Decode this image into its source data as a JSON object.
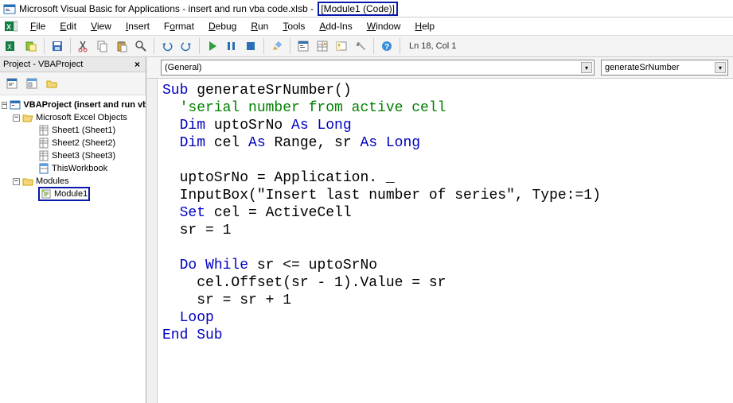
{
  "title": {
    "prefix": "Microsoft Visual Basic for Applications - insert and run vba code.xlsb - ",
    "module": "[Module1 (Code)]"
  },
  "menu": {
    "file": "File",
    "edit": "Edit",
    "view": "View",
    "insert": "Insert",
    "format": "Format",
    "debug": "Debug",
    "run": "Run",
    "tools": "Tools",
    "addins": "Add-Ins",
    "window": "Window",
    "help": "Help"
  },
  "toolbar": {
    "status": "Ln 18, Col 1"
  },
  "project": {
    "title": "Project - VBAProject",
    "root": "VBAProject (insert and run vba code.xlsb)",
    "excelObjects": "Microsoft Excel Objects",
    "sheet1": "Sheet1 (Sheet1)",
    "sheet2": "Sheet2 (Sheet2)",
    "sheet3": "Sheet3 (Sheet3)",
    "thisWorkbook": "ThisWorkbook",
    "modules": "Modules",
    "module1": "Module1"
  },
  "codeDrop": {
    "left": "(General)",
    "right": "generateSrNumber"
  },
  "code": {
    "l1a": "Sub",
    "l1b": " generateSrNumber()",
    "l2a": "  'serial number from active cell",
    "l3a": "  ",
    "l3b": "Dim",
    "l3c": " uptoSrNo ",
    "l3d": "As Long",
    "l4a": "  ",
    "l4b": "Dim",
    "l4c": " cel ",
    "l4d": "As",
    "l4e": " Range, sr ",
    "l4f": "As Long",
    "l5": "",
    "l6": "  uptoSrNo = Application. _",
    "l7": "  InputBox(\"Insert last number of series\", Type:=1)",
    "l8a": "  ",
    "l8b": "Set",
    "l8c": " cel = ActiveCell",
    "l9": "  sr = 1",
    "l10": "",
    "l11a": "  ",
    "l11b": "Do While",
    "l11c": " sr <= uptoSrNo",
    "l12": "    cel.Offset(sr - 1).Value = sr",
    "l13": "    sr = sr + 1",
    "l14a": "  ",
    "l14b": "Loop",
    "l15a": "End Sub"
  }
}
